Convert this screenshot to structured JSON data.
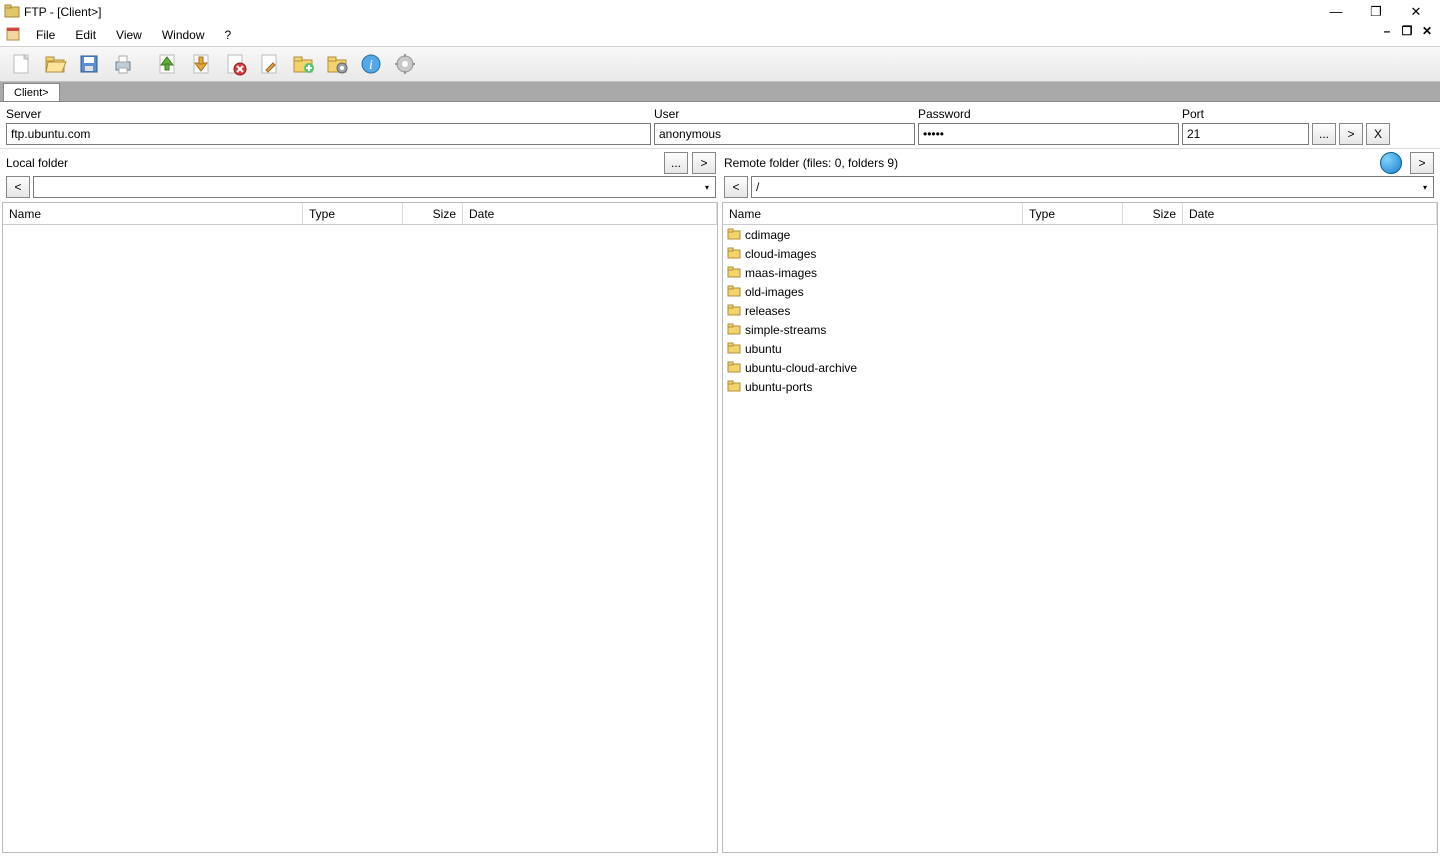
{
  "window": {
    "title": "FTP - [Client>]"
  },
  "menu": {
    "items": [
      "File",
      "Edit",
      "View",
      "Window",
      "?"
    ]
  },
  "tabs": {
    "active": "Client>"
  },
  "connection": {
    "server_label": "Server",
    "server_value": "ftp.ubuntu.com",
    "user_label": "User",
    "user_value": "anonymous",
    "password_label": "Password",
    "password_value": "•••••",
    "port_label": "Port",
    "port_value": "21",
    "browse_btn": "...",
    "go_btn": ">",
    "close_btn": "X"
  },
  "local": {
    "label": "Local folder",
    "path": "",
    "browse": "...",
    "go": ">",
    "back": "<"
  },
  "remote": {
    "label": "Remote folder (files: 0, folders 9)",
    "path": "/",
    "go": ">",
    "back": "<"
  },
  "columns": {
    "name": "Name",
    "type": "Type",
    "size": "Size",
    "date": "Date"
  },
  "remote_files": [
    {
      "name": "cdimage"
    },
    {
      "name": "cloud-images"
    },
    {
      "name": "maas-images"
    },
    {
      "name": "old-images"
    },
    {
      "name": "releases"
    },
    {
      "name": "simple-streams"
    },
    {
      "name": "ubuntu"
    },
    {
      "name": "ubuntu-cloud-archive"
    },
    {
      "name": "ubuntu-ports"
    }
  ],
  "titlebar_controls": {
    "min": "—",
    "max": "❐",
    "close": "✕"
  },
  "mdi_controls": {
    "min": "–",
    "max": "❐",
    "close": "✕"
  }
}
